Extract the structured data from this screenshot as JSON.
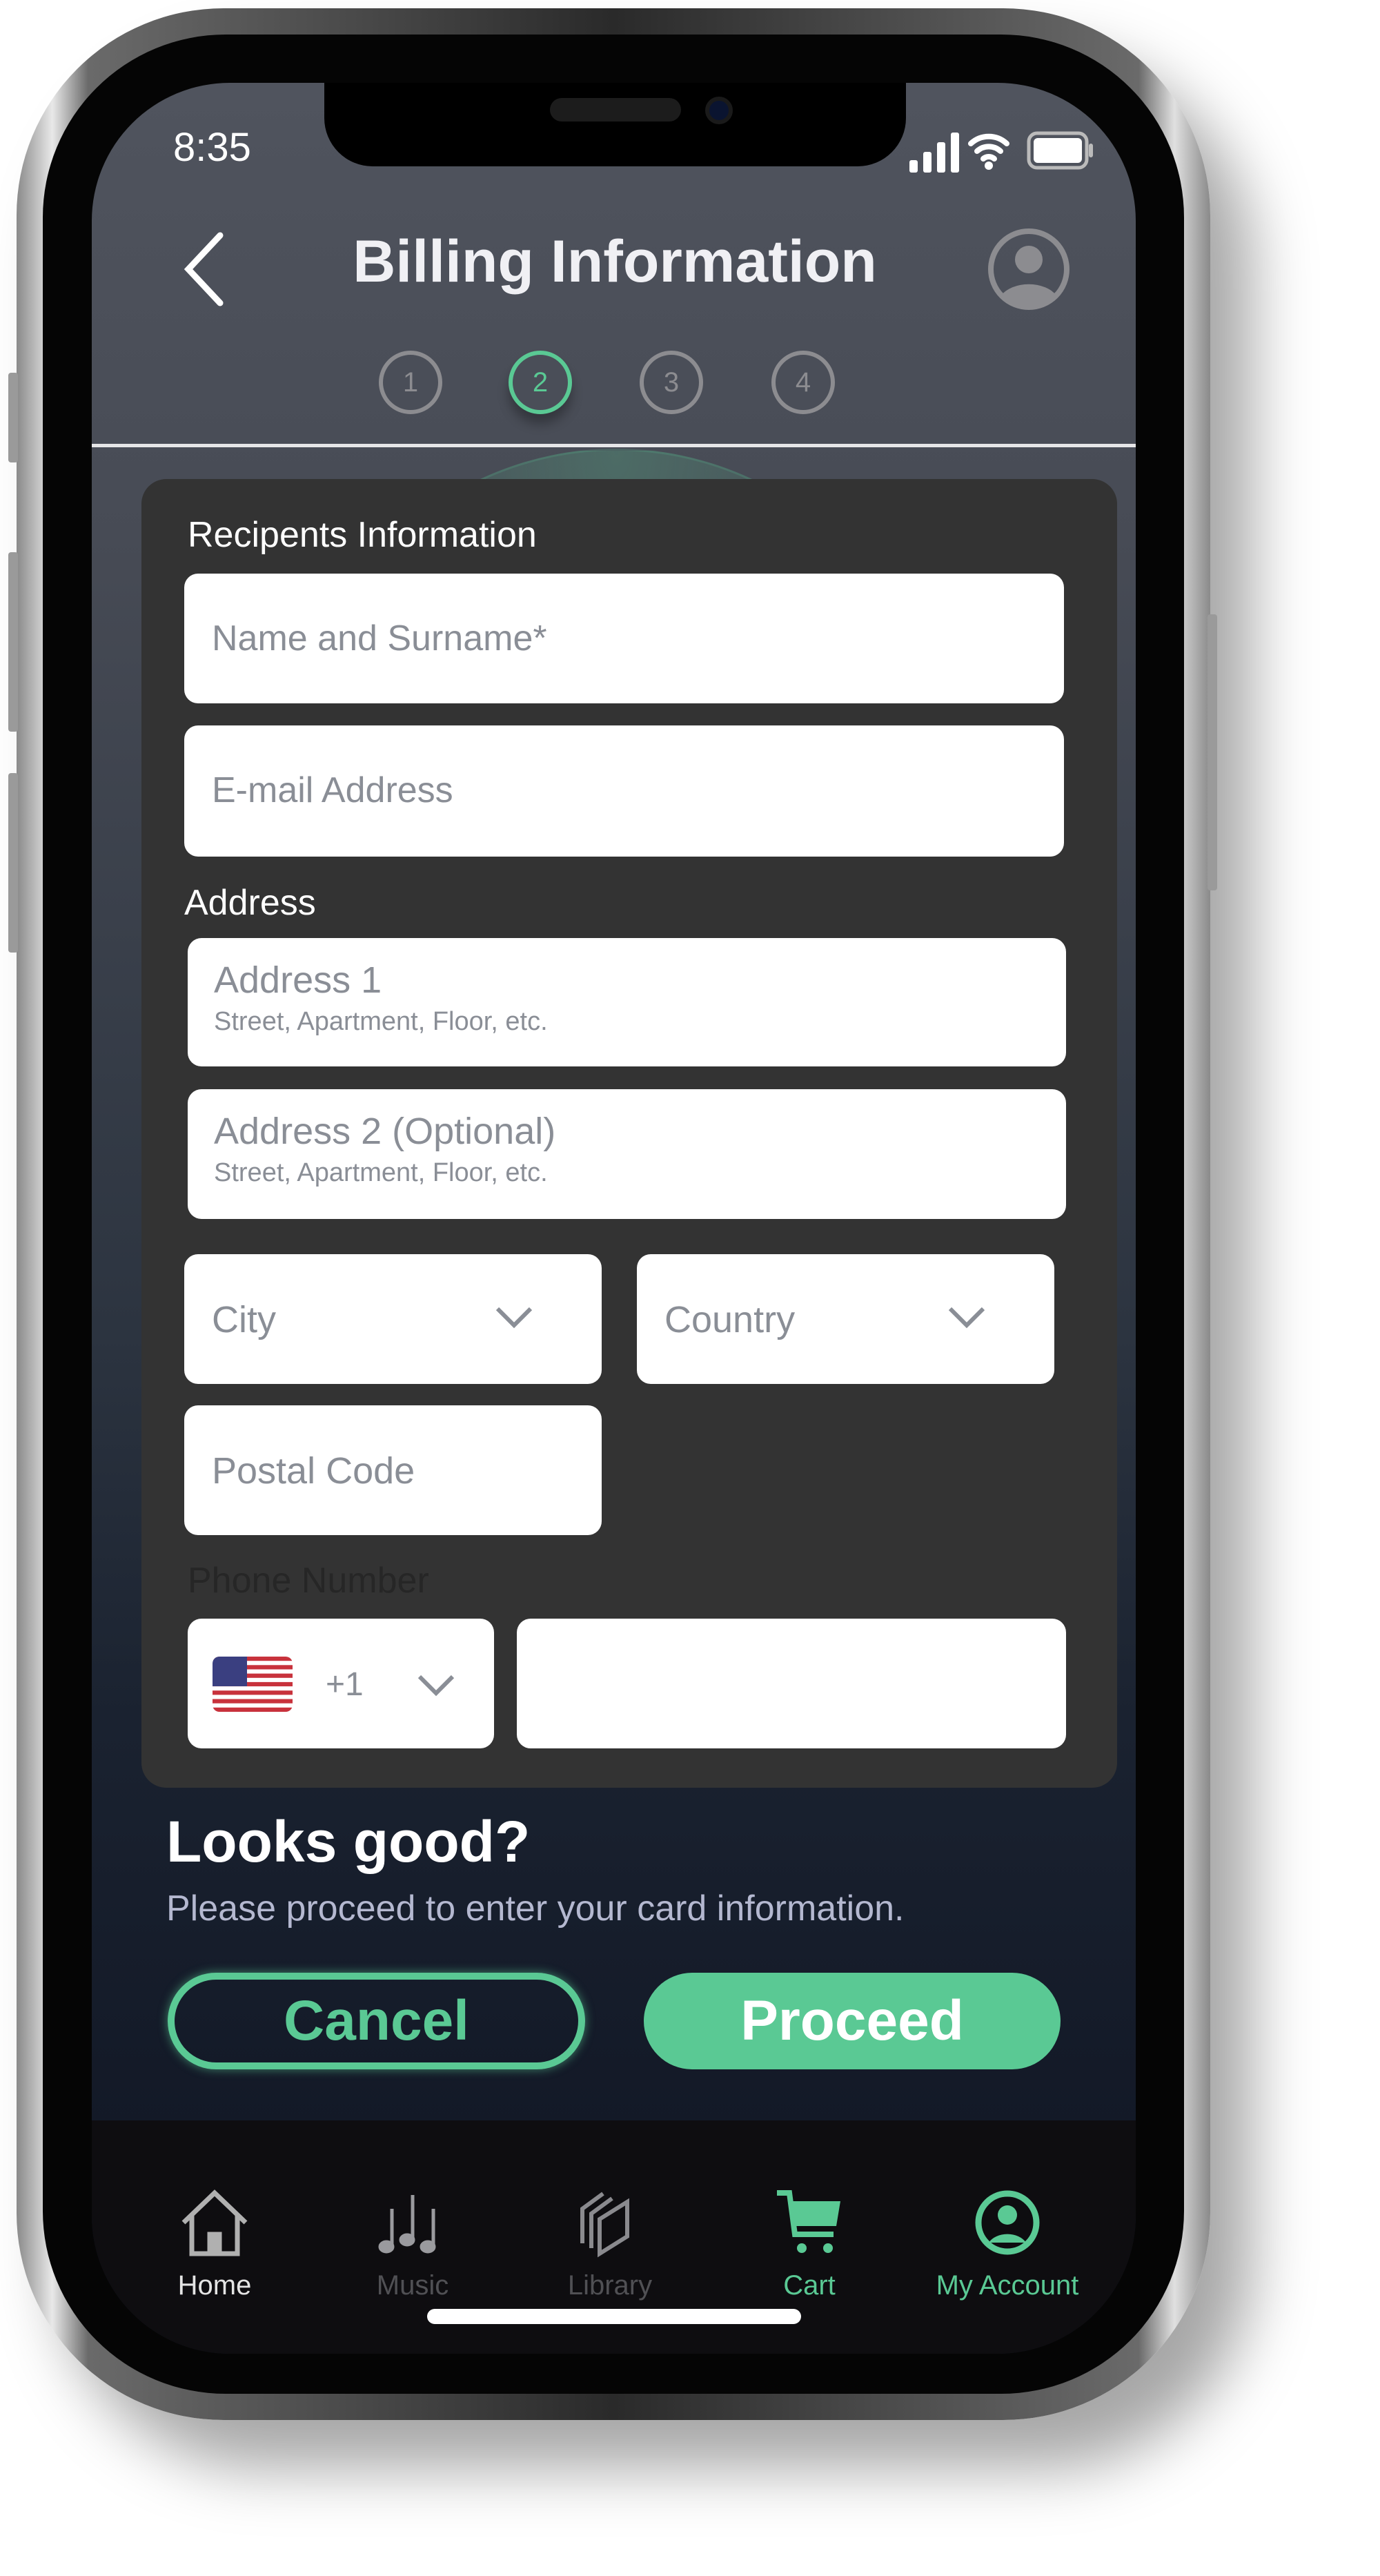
{
  "status_bar": {
    "time": "8:35"
  },
  "header": {
    "title": "Billing Information",
    "steps": [
      "1",
      "2",
      "3",
      "4"
    ],
    "active_step": 2
  },
  "form": {
    "section_recipient": "Recipents Information",
    "name_placeholder": "Name and Surname*",
    "email_placeholder": "E-mail Address",
    "section_address": "Address",
    "address1_label": "Address 1",
    "address1_hint": "Street, Apartment, Floor, etc.",
    "address2_label": "Address 2 (Optional)",
    "address2_hint": "Street, Apartment, Floor, etc.",
    "city_placeholder": "City",
    "country_placeholder": "Country",
    "postal_placeholder": "Postal Code",
    "section_phone": "Phone Number",
    "phone_code": "+1",
    "phone_value": ""
  },
  "confirm": {
    "title": "Looks good?",
    "subtitle": "Please proceed to enter your card information.",
    "cancel_label": "Cancel",
    "proceed_label": "Proceed"
  },
  "tabbar": {
    "items": [
      {
        "label": "Home"
      },
      {
        "label": "Music"
      },
      {
        "label": "Library"
      },
      {
        "label": "Cart"
      },
      {
        "label": "My Account"
      }
    ]
  },
  "colors": {
    "accent": "#5ac994",
    "card": "#333333",
    "tabbar": "#0e0d10"
  }
}
